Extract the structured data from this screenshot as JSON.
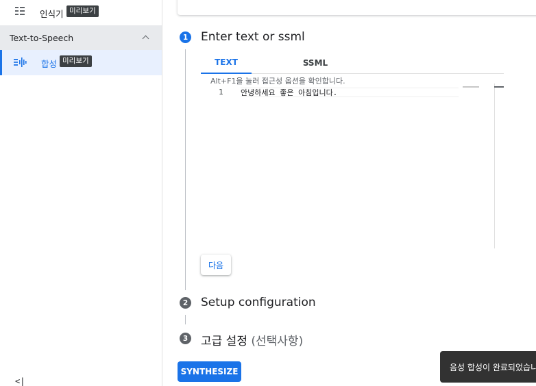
{
  "sidebar": {
    "recognition": {
      "label": "인식기",
      "badge": "미리보기",
      "icon": "list-icon"
    },
    "tts_section": {
      "title": "Text-to-Speech",
      "icon": "chevron-up-icon"
    },
    "synthesis": {
      "label": "합성",
      "badge": "미리보기",
      "icon": "speech-wave-icon"
    },
    "collapse": {
      "label": "<|"
    }
  },
  "steps": [
    {
      "number": "1",
      "title": "Enter text or ssml",
      "state": "active"
    },
    {
      "number": "2",
      "title": "Setup configuration",
      "state": "idle"
    },
    {
      "number": "3",
      "title": "고급 설정",
      "subtitle": "(선택사항)",
      "state": "idle"
    }
  ],
  "tabs": [
    {
      "label": "TEXT",
      "selected": true
    },
    {
      "label": "SSML",
      "selected": false
    }
  ],
  "editor": {
    "hint": "Alt+F1을 눌러 접근성 옵션을 확인합니다.",
    "lines": [
      {
        "number": "1",
        "text": "안녕하세요 좋은 아침입니다."
      }
    ]
  },
  "next_button": "다음",
  "synthesize_button": "SYNTHESIZE",
  "toast": "음성 합성이 완료되었습니다",
  "colors": {
    "accent": "#1a73e8",
    "selected_bg": "#e8f0fe",
    "badge_bg": "#3c4043",
    "toast_bg": "#323232"
  }
}
